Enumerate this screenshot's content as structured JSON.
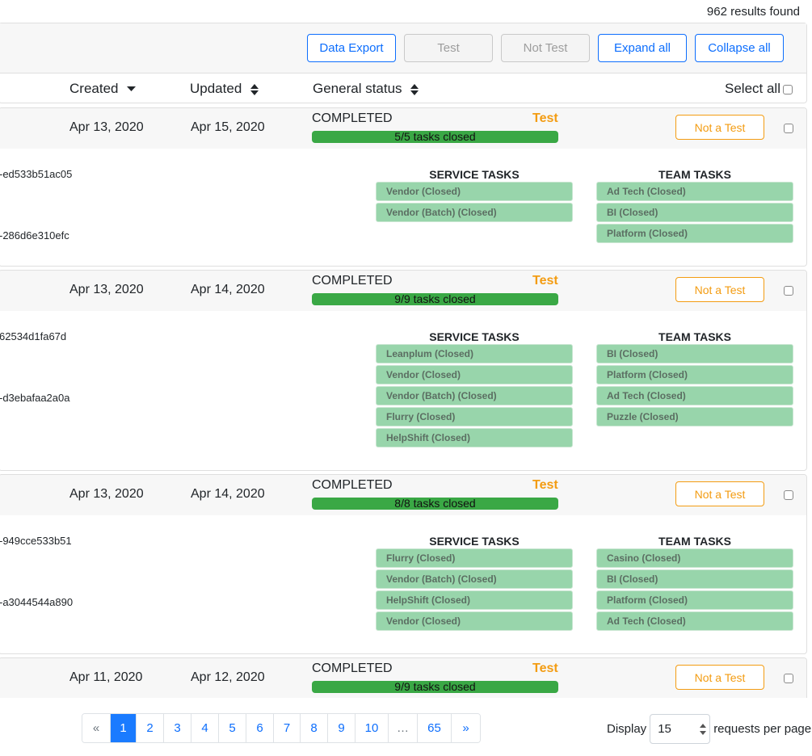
{
  "results_found": "962 results found",
  "toolbar": {
    "data_export": "Data Export",
    "test": "Test",
    "not_test": "Not Test",
    "expand_all": "Expand all",
    "collapse_all": "Collapse all"
  },
  "columns": {
    "created": "Created",
    "updated": "Updated",
    "general_status": "General status",
    "select_all": "Select all"
  },
  "requests": [
    {
      "created": "Apr 13, 2020",
      "updated": "Apr 15, 2020",
      "status": "COMPLETED",
      "test_label": "Test",
      "progress_text": "5/5 tasks closed",
      "progress_fraction": 1.0,
      "not_test_label": "Not a Test",
      "uuid_1": "-ed533b51ac05",
      "uuid_2": "-286d6e310efc",
      "service_title": "SERVICE TASKS",
      "team_title": "TEAM TASKS",
      "service_tasks": [
        "Vendor (Closed)",
        "Vendor (Batch) (Closed)"
      ],
      "team_tasks": [
        "Ad Tech (Closed)",
        "BI (Closed)",
        "Platform (Closed)"
      ]
    },
    {
      "created": "Apr 13, 2020",
      "updated": "Apr 14, 2020",
      "status": "COMPLETED",
      "test_label": "Test",
      "progress_text": "9/9 tasks closed",
      "progress_fraction": 1.0,
      "not_test_label": "Not a Test",
      "uuid_1": "62534d1fa67d",
      "uuid_2": "-d3ebafaa2a0a",
      "service_title": "SERVICE TASKS",
      "team_title": "TEAM TASKS",
      "service_tasks": [
        "Leanplum (Closed)",
        "Vendor (Closed)",
        "Vendor (Batch) (Closed)",
        "Flurry (Closed)",
        "HelpShift (Closed)"
      ],
      "team_tasks": [
        "BI (Closed)",
        "Platform (Closed)",
        "Ad Tech (Closed)",
        "Puzzle (Closed)"
      ]
    },
    {
      "created": "Apr 13, 2020",
      "updated": "Apr 14, 2020",
      "status": "COMPLETED",
      "test_label": "Test",
      "progress_text": "8/8 tasks closed",
      "progress_fraction": 1.0,
      "not_test_label": "Not a Test",
      "uuid_1": "-949cce533b51",
      "uuid_2": "-a3044544a890",
      "service_title": "SERVICE TASKS",
      "team_title": "TEAM TASKS",
      "service_tasks": [
        "Flurry (Closed)",
        "Vendor (Batch) (Closed)",
        "HelpShift (Closed)",
        "Vendor (Closed)"
      ],
      "team_tasks": [
        "Casino (Closed)",
        "BI (Closed)",
        "Platform (Closed)",
        "Ad Tech (Closed)"
      ]
    },
    {
      "created": "Apr 11, 2020",
      "updated": "Apr 12, 2020",
      "status": "COMPLETED",
      "test_label": "Test",
      "progress_text": "9/9 tasks closed",
      "progress_fraction": 1.0,
      "not_test_label": "Not a Test"
    }
  ],
  "pagination": {
    "prev": "«",
    "pages": [
      "1",
      "2",
      "3",
      "4",
      "5",
      "6",
      "7",
      "8",
      "9",
      "10",
      "…",
      "65"
    ],
    "next": "»",
    "active": "1"
  },
  "display": {
    "label": "Display",
    "value": "15",
    "suffix": "requests per page"
  },
  "colors": {
    "primary": "#0d6efd",
    "warning": "#f39c12",
    "progress": "#3aa845",
    "task_chip": "#98d5ab"
  }
}
